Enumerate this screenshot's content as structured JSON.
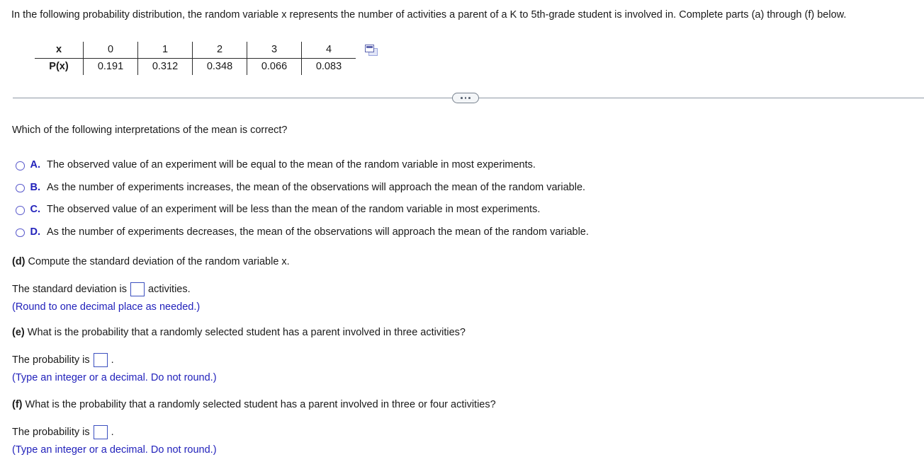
{
  "intro": {
    "text": "In the following probability distribution, the random variable x represents the number of activities a parent of a K to 5th-grade student is involved in. Complete parts (a) through (f) below."
  },
  "prob_table": {
    "row_label_x": "x",
    "row_label_px": "P(x)",
    "x_values": [
      "0",
      "1",
      "2",
      "3",
      "4"
    ],
    "p_values": [
      "0.191",
      "0.312",
      "0.348",
      "0.066",
      "0.083"
    ],
    "copy_icon": "copy-to-spreadsheet-icon"
  },
  "divider": {
    "ellipsis_label": "...",
    "icon": "ellipsis-icon"
  },
  "question": {
    "text": "Which of the following interpretations of the mean is correct?",
    "options": [
      {
        "letter": "A.",
        "text": "The observed value of an experiment will be equal to the mean of the random variable in most experiments.",
        "selected": false
      },
      {
        "letter": "B.",
        "text": "As the number of experiments increases, the mean of the observations will approach the mean of the random variable.",
        "selected": false
      },
      {
        "letter": "C.",
        "text": "The observed value of an experiment will be less than the mean of the random variable in most experiments.",
        "selected": false
      },
      {
        "letter": "D.",
        "text": "As the number of experiments decreases, the mean of the observations will approach the mean of the random variable.",
        "selected": false
      }
    ]
  },
  "part_d": {
    "tag": "(d)",
    "prompt": " Compute the standard deviation of the random variable x.",
    "answer_prefix": "The standard deviation is",
    "answer_value": "",
    "answer_suffix": "activities.",
    "hint": "(Round to one decimal place as needed.)"
  },
  "part_e": {
    "tag": "(e)",
    "prompt": " What is the probability that a randomly selected student has a parent involved in three activities?",
    "answer_prefix": "The probability is",
    "answer_value": "",
    "answer_suffix": ".",
    "hint": "(Type an integer or a decimal. Do not round.)"
  },
  "part_f": {
    "tag": "(f)",
    "prompt": " What is the probability that a randomly selected student has a parent involved in three or four activities?",
    "answer_prefix": "The probability is",
    "answer_value": "",
    "answer_suffix": ".",
    "hint": "(Type an integer or a decimal. Do not round.)"
  },
  "colors": {
    "link_blue": "#2222bb",
    "radio_blue": "#5b5bcc",
    "divider_gray": "#8e98a4",
    "text_dark": "#1a1a1a"
  }
}
